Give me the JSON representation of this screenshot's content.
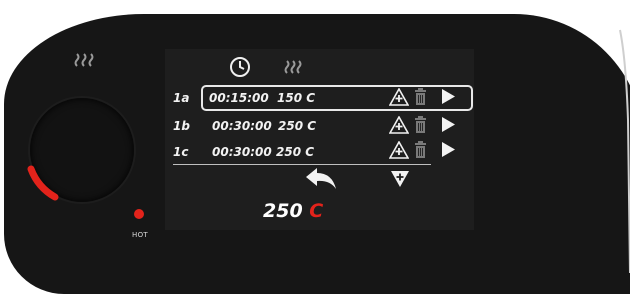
{
  "panel": {
    "hot_label": "HOT"
  },
  "schedule": {
    "rows": [
      {
        "id": "1a",
        "time": "00:15:00",
        "temp": "150 C",
        "selected": true
      },
      {
        "id": "1b",
        "time": "00:30:00",
        "temp": "250 C",
        "selected": false
      },
      {
        "id": "1c",
        "time": "00:30:00",
        "temp": "250 C",
        "selected": false
      }
    ]
  },
  "status": {
    "current_temp_value": "250",
    "current_temp_unit": "C"
  },
  "colors": {
    "panel": "#161616",
    "screen": "#1e1e1e",
    "accent": "#e3231b",
    "text": "#f2f2f2"
  },
  "icons": {
    "header": [
      "clock-icon",
      "heat-icon"
    ],
    "row_actions": [
      "add-step-icon",
      "delete-icon",
      "play-icon"
    ],
    "footer": [
      "back-icon",
      "move-down-icon"
    ]
  }
}
